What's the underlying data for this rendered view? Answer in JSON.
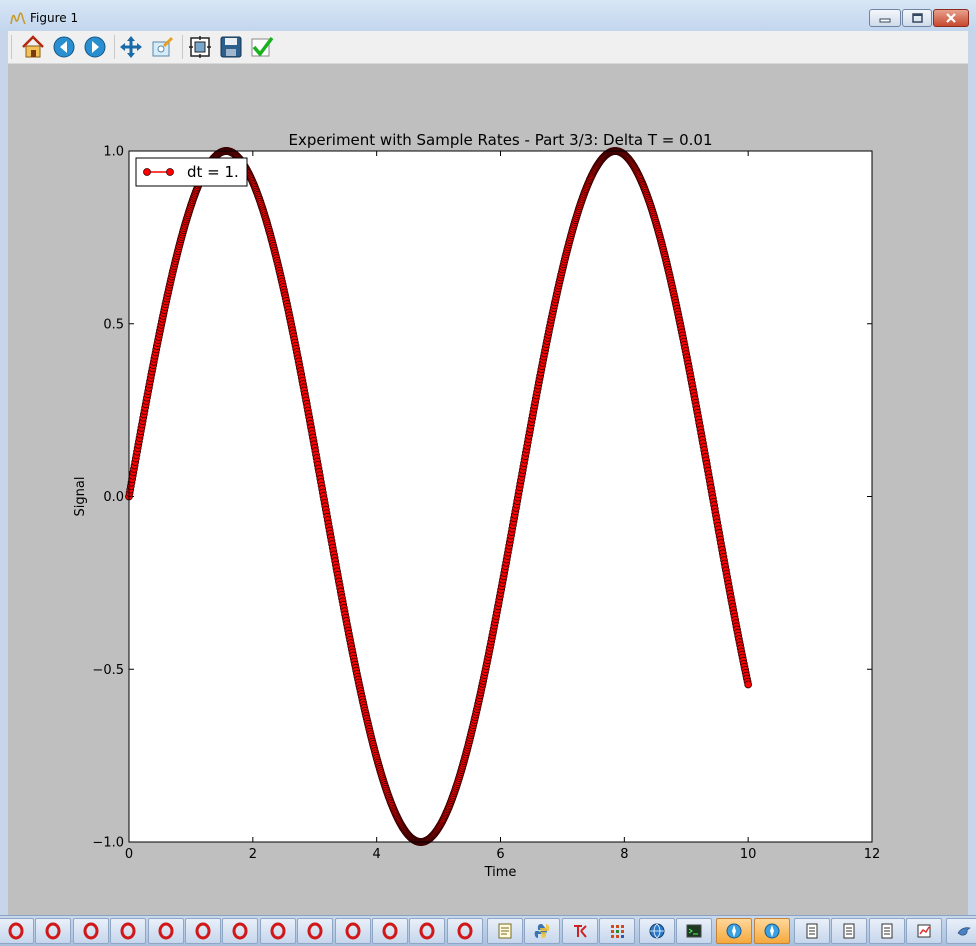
{
  "window": {
    "title": "Figure 1"
  },
  "toolbar": {
    "items": [
      {
        "icon": "home-icon"
      },
      {
        "icon": "back-arrow-icon"
      },
      {
        "icon": "forward-arrow-icon"
      },
      {
        "icon": "pan-icon"
      },
      {
        "icon": "zoom-icon"
      },
      {
        "icon": "subplots-icon"
      },
      {
        "icon": "save-icon"
      },
      {
        "icon": "checkmark-icon"
      }
    ]
  },
  "colors": {
    "line": "#ff0000",
    "marker_edge": "#3a0000",
    "accent": "#1a6aa8"
  },
  "chart_data": {
    "type": "line",
    "title": "Experiment with Sample Rates - Part 3/3: Delta T = 0.01",
    "xlabel": "Time",
    "ylabel": "Signal",
    "xlim": [
      0,
      12
    ],
    "ylim": [
      -1.0,
      1.0
    ],
    "xticks": [
      0,
      2,
      4,
      6,
      8,
      10,
      12
    ],
    "xtick_labels": [
      "0",
      "2",
      "4",
      "6",
      "8",
      "10",
      "12"
    ],
    "yticks": [
      -1.0,
      -0.5,
      0.0,
      0.5,
      1.0
    ],
    "ytick_labels": [
      "−1.0",
      "−0.5",
      "0.0",
      "0.5",
      "1.0"
    ],
    "legend": {
      "position": "top-left"
    },
    "series": [
      {
        "name": "dt = 1.",
        "function": "sin(t)",
        "x_start": 0,
        "x_end": 10,
        "dx": 0.01,
        "marker": "circle",
        "color": "#ff0000"
      }
    ]
  },
  "taskbar": {
    "items": [
      {
        "icon": "opera-icon"
      },
      {
        "icon": "opera-icon"
      },
      {
        "icon": "opera-icon"
      },
      {
        "icon": "opera-icon"
      },
      {
        "icon": "opera-icon"
      },
      {
        "icon": "opera-icon"
      },
      {
        "icon": "opera-icon"
      },
      {
        "icon": "opera-icon"
      },
      {
        "icon": "opera-icon"
      },
      {
        "icon": "opera-icon"
      },
      {
        "icon": "opera-icon"
      },
      {
        "icon": "opera-icon"
      },
      {
        "icon": "opera-icon"
      },
      {
        "icon": "notepad-icon"
      },
      {
        "icon": "python-icon"
      },
      {
        "icon": "tk-icon"
      },
      {
        "icon": "grid-app-icon"
      },
      {
        "icon": "globe-icon"
      },
      {
        "icon": "terminal-icon"
      },
      {
        "icon": "compass-icon"
      },
      {
        "icon": "compass-icon"
      },
      {
        "icon": "document-icon"
      },
      {
        "icon": "document-icon"
      },
      {
        "icon": "document-icon"
      },
      {
        "icon": "chart-app-icon"
      },
      {
        "icon": "bird-icon"
      }
    ]
  }
}
